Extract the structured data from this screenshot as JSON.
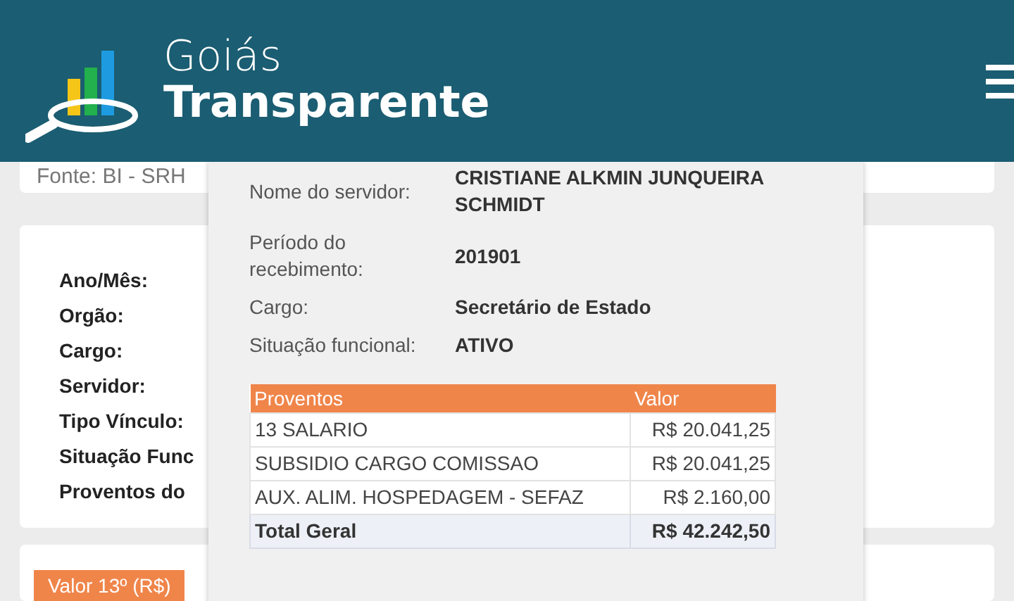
{
  "header": {
    "logo_line_1": "Goiás",
    "logo_line_2": "Transparente"
  },
  "source_note": "Fonte: BI - SRH",
  "summary_labels": [
    "Ano/Mês:",
    "Orgão:",
    "Cargo:",
    "Servidor:",
    "Tipo Vínculo:",
    "Situação Func",
    "Proventos do"
  ],
  "value_tab": "Valor 13º (R$)",
  "detail_popup": {
    "fields": [
      {
        "label": "Nome do servidor:",
        "value": "CRISTIANE ALKMIN JUNQUEIRA SCHMIDT"
      },
      {
        "label": "Período do recebimento:",
        "value": "201901"
      },
      {
        "label": "Cargo:",
        "value": "Secretário de Estado"
      },
      {
        "label": "Situação funcional:",
        "value": "ATIVO"
      }
    ],
    "table": {
      "columns": [
        "Proventos",
        "Valor"
      ],
      "rows": [
        {
          "item": "13 SALARIO",
          "value": "R$ 20.041,25"
        },
        {
          "item": "SUBSIDIO CARGO COMISSAO",
          "value": "R$ 20.041,25"
        },
        {
          "item": "AUX. ALIM. HOSPEDAGEM - SEFAZ",
          "value": "R$ 2.160,00"
        }
      ],
      "total": {
        "label": "Total Geral",
        "value": "R$ 42.242,50"
      }
    }
  }
}
